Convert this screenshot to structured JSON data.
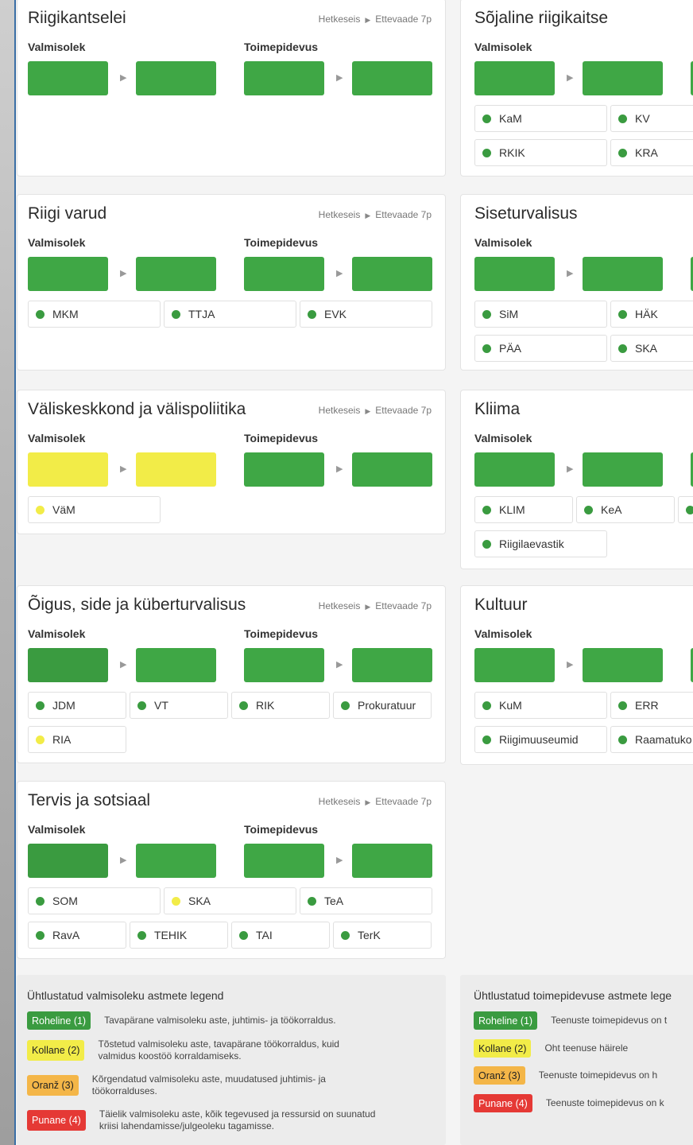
{
  "common": {
    "current": "Hetkeseis",
    "forecast": "Ettevaade 7p",
    "readiness": "Valmisolek",
    "continuity": "Toimepidevus"
  },
  "cards": {
    "riigikantselei": {
      "title": "Riigikantselei"
    },
    "riigivarud": {
      "title": "Riigi varud",
      "tags": [
        "MKM",
        "TTJA",
        "EVK"
      ]
    },
    "valiskeskkond": {
      "title": "Väliskeskkond ja välispoliitika",
      "tags": [
        "VäM"
      ]
    },
    "oigus": {
      "title": "Õigus, side ja küberturvalisus",
      "tags": [
        "JDM",
        "VT",
        "RIK",
        "Prokuratuur",
        "RIA"
      ]
    },
    "tervis": {
      "title": "Tervis ja sotsiaal",
      "tags": [
        "SOM",
        "SKA",
        "TeA",
        "RavA",
        "TEHIK",
        "TAI",
        "TerK"
      ]
    },
    "sojaline": {
      "title": "Sõjaline riigikaitse",
      "tags": [
        "KaM",
        "KV",
        "RKIK",
        "KRA"
      ]
    },
    "siseturvalisus": {
      "title": "Siseturvalisus",
      "tags": [
        "SiM",
        "HÄK",
        "PÄA",
        "SKA"
      ]
    },
    "kliima": {
      "title": "Kliima",
      "tags": [
        "KLIM",
        "KeA",
        "Riigilaevastik"
      ]
    },
    "kultuur": {
      "title": "Kultuur",
      "tags": [
        "KuM",
        "ERR",
        "Riigimuuseumid",
        "Raamatuko"
      ]
    }
  },
  "legend_readiness": {
    "title": "Ühtlustatud valmisoleku astmete legend",
    "items": [
      {
        "badge": "Roheline (1)",
        "desc": "Tavapärane valmisoleku aste, juhtimis- ja töökorraldus."
      },
      {
        "badge": "Kollane (2)",
        "desc1": "Tõstetud valmisoleku aste, tavapärane töökorraldus, kuid",
        "desc2": "valmidus koostöö korraldamiseks."
      },
      {
        "badge": "Oranž (3)",
        "desc1": "Kõrgendatud valmisoleku aste, muudatused juhtimis- ja",
        "desc2": "töökorralduses."
      },
      {
        "badge": "Punane (4)",
        "desc1": "Täielik valmisoleku aste, kõik tegevused ja ressursid on suunatud",
        "desc2": "kriisi lahendamisse/julgeoleku tagamisse."
      }
    ]
  },
  "legend_continuity": {
    "title": "Ühtlustatud toimepidevuse astmete lege",
    "items": [
      {
        "badge": "Roheline (1)",
        "desc": "Teenuste toimepidevus on t"
      },
      {
        "badge": "Kollane (2)",
        "desc": "Oht teenuse häirele"
      },
      {
        "badge": "Oranž (3)",
        "desc": "Teenuste toimepidevus on h"
      },
      {
        "badge": "Punane (4)",
        "desc": "Teenuste toimepidevus on k"
      }
    ]
  },
  "colors": {
    "green": "#3fa745",
    "yellow": "#f2ec48",
    "orange": "#f4b648",
    "red": "#e53935"
  }
}
